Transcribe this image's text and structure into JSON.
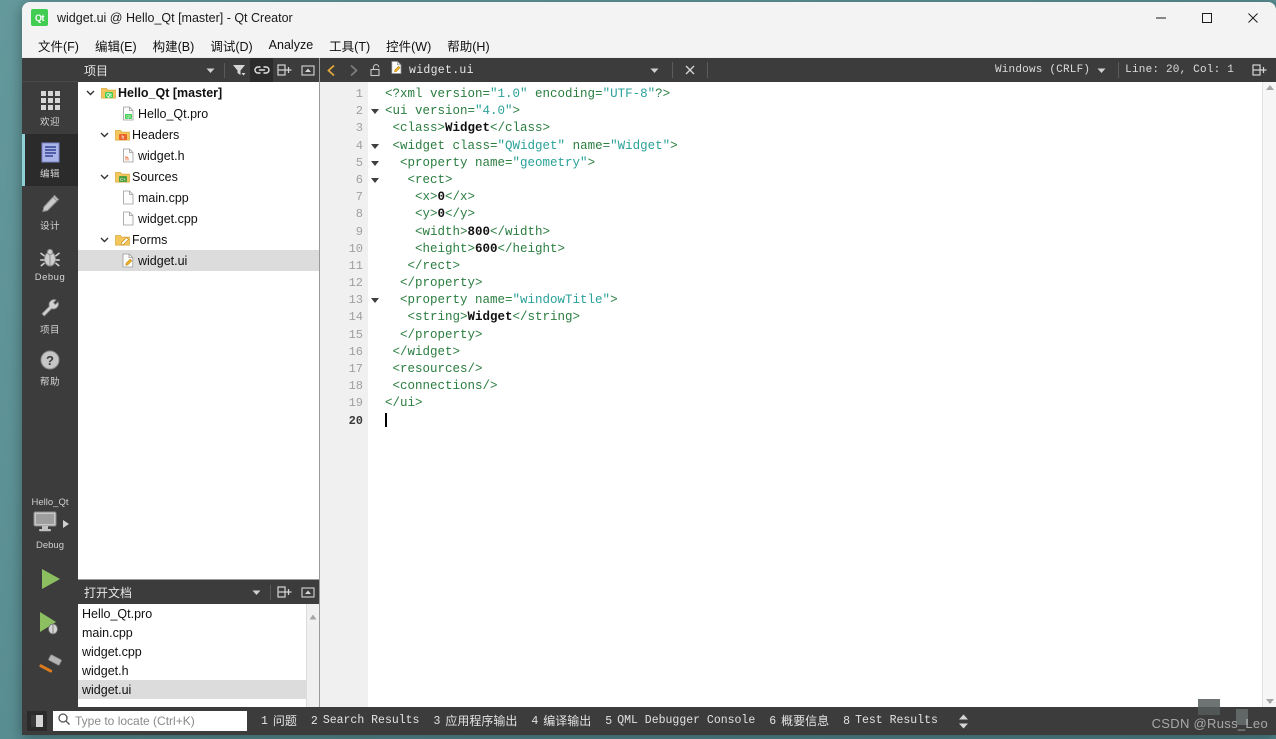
{
  "window": {
    "title": "widget.ui @ Hello_Qt [master] - Qt Creator",
    "app_icon": "qt-logo-icon",
    "minimize_label": "—",
    "maximize_label": "☐",
    "close_label": "✕"
  },
  "menubar": {
    "items": [
      {
        "label": "文件(F)"
      },
      {
        "label": "编辑(E)"
      },
      {
        "label": "构建(B)"
      },
      {
        "label": "调试(D)"
      },
      {
        "label": "Analyze"
      },
      {
        "label": "工具(T)"
      },
      {
        "label": "控件(W)"
      },
      {
        "label": "帮助(H)"
      }
    ]
  },
  "modebar": {
    "items": [
      {
        "label": "欢迎",
        "icon": "grid-icon",
        "active": false
      },
      {
        "label": "编辑",
        "icon": "document-lines-icon",
        "active": true
      },
      {
        "label": "设计",
        "icon": "pencil-icon",
        "active": false
      },
      {
        "label": "Debug",
        "icon": "bug-icon",
        "active": false
      },
      {
        "label": "项目",
        "icon": "wrench-icon",
        "active": false
      },
      {
        "label": "帮助",
        "icon": "question-circle-icon",
        "active": false
      }
    ],
    "kit_name": "Hello_Qt",
    "kit_config": "Debug",
    "kit_icon": "desktop-monitor-icon",
    "run_button": "run-icon",
    "debug_button": "debug-run-icon",
    "build_button": "hammer-icon"
  },
  "project_panel": {
    "title": "项目",
    "tools": [
      {
        "name": "combo-arrow-icon"
      },
      {
        "name": "filter-icon"
      },
      {
        "name": "link-icon",
        "active": true
      },
      {
        "name": "split-icon"
      },
      {
        "name": "close-panel-icon"
      }
    ],
    "tree": [
      {
        "label": "Hello_Qt [master]",
        "depth": 0,
        "icon": "qt-project-folder-icon",
        "expanded": true,
        "bold": true,
        "selected": false
      },
      {
        "label": "Hello_Qt.pro",
        "depth": 1,
        "icon": "qt-pro-file-icon",
        "expanded": null,
        "bold": false,
        "selected": false
      },
      {
        "label": "Headers",
        "depth": 1,
        "icon": "headers-folder-icon",
        "expanded": true,
        "bold": false,
        "selected": false
      },
      {
        "label": "widget.h",
        "depth": 2,
        "icon": "header-file-icon",
        "expanded": null,
        "bold": false,
        "selected": false
      },
      {
        "label": "Sources",
        "depth": 1,
        "icon": "sources-folder-icon",
        "expanded": true,
        "bold": false,
        "selected": false
      },
      {
        "label": "main.cpp",
        "depth": 2,
        "icon": "cpp-file-icon",
        "expanded": null,
        "bold": false,
        "selected": false
      },
      {
        "label": "widget.cpp",
        "depth": 2,
        "icon": "cpp-file-icon",
        "expanded": null,
        "bold": false,
        "selected": false
      },
      {
        "label": "Forms",
        "depth": 1,
        "icon": "forms-folder-icon",
        "expanded": true,
        "bold": false,
        "selected": false
      },
      {
        "label": "widget.ui",
        "depth": 2,
        "icon": "ui-file-icon",
        "expanded": null,
        "bold": false,
        "selected": true
      }
    ]
  },
  "open_documents": {
    "title": "打开文档",
    "tools": [
      {
        "name": "combo-arrow-icon"
      },
      {
        "name": "split-icon"
      },
      {
        "name": "close-panel-icon"
      }
    ],
    "items": [
      {
        "label": "Hello_Qt.pro",
        "selected": false
      },
      {
        "label": "main.cpp",
        "selected": false
      },
      {
        "label": "widget.cpp",
        "selected": false
      },
      {
        "label": "widget.h",
        "selected": false
      },
      {
        "label": "widget.ui",
        "selected": true
      }
    ]
  },
  "editor_toolbar": {
    "back_icon": "chevron-left-icon",
    "forward_icon": "chevron-right-icon",
    "lock_icon": "unlocked-icon",
    "file_icon": "ui-file-icon",
    "file_name": "widget.ui",
    "dropdown_icon": "chevron-down-icon",
    "close_icon": "close-icon",
    "line_ending": "Windows (CRLF)",
    "line_ending_arrow": "chevron-down-icon",
    "cursor_position": "Line: 20, Col: 1",
    "split_icon": "split-editor-icon"
  },
  "editor": {
    "current_line": 20,
    "total_lines": 20,
    "lines": [
      {
        "n": 1,
        "fold": false,
        "tokens": [
          {
            "t": "tg",
            "v": "<?xml "
          },
          {
            "t": "at",
            "v": "version="
          },
          {
            "t": "av",
            "v": "\"1.0\""
          },
          {
            "t": "at",
            "v": " encoding="
          },
          {
            "t": "av",
            "v": "\"UTF-8\""
          },
          {
            "t": "tg",
            "v": "?>"
          }
        ]
      },
      {
        "n": 2,
        "fold": true,
        "tokens": [
          {
            "t": "tg",
            "v": "<ui "
          },
          {
            "t": "at",
            "v": "version="
          },
          {
            "t": "av",
            "v": "\"4.0\""
          },
          {
            "t": "tg",
            "v": ">"
          }
        ]
      },
      {
        "n": 3,
        "fold": false,
        "tokens": [
          {
            "t": "pl",
            "v": " "
          },
          {
            "t": "tg",
            "v": "<class>"
          },
          {
            "t": "tx",
            "v": "Widget"
          },
          {
            "t": "tg",
            "v": "</class>"
          }
        ]
      },
      {
        "n": 4,
        "fold": true,
        "tokens": [
          {
            "t": "pl",
            "v": " "
          },
          {
            "t": "tg",
            "v": "<widget "
          },
          {
            "t": "at",
            "v": "class="
          },
          {
            "t": "av",
            "v": "\"QWidget\""
          },
          {
            "t": "at",
            "v": " name="
          },
          {
            "t": "av",
            "v": "\"Widget\""
          },
          {
            "t": "tg",
            "v": ">"
          }
        ]
      },
      {
        "n": 5,
        "fold": true,
        "tokens": [
          {
            "t": "pl",
            "v": "  "
          },
          {
            "t": "tg",
            "v": "<property "
          },
          {
            "t": "at",
            "v": "name="
          },
          {
            "t": "av",
            "v": "\"geometry\""
          },
          {
            "t": "tg",
            "v": ">"
          }
        ]
      },
      {
        "n": 6,
        "fold": true,
        "tokens": [
          {
            "t": "pl",
            "v": "   "
          },
          {
            "t": "tg",
            "v": "<rect>"
          }
        ]
      },
      {
        "n": 7,
        "fold": false,
        "tokens": [
          {
            "t": "pl",
            "v": "    "
          },
          {
            "t": "tg",
            "v": "<x>"
          },
          {
            "t": "tx",
            "v": "0"
          },
          {
            "t": "tg",
            "v": "</x>"
          }
        ]
      },
      {
        "n": 8,
        "fold": false,
        "tokens": [
          {
            "t": "pl",
            "v": "    "
          },
          {
            "t": "tg",
            "v": "<y>"
          },
          {
            "t": "tx",
            "v": "0"
          },
          {
            "t": "tg",
            "v": "</y>"
          }
        ]
      },
      {
        "n": 9,
        "fold": false,
        "tokens": [
          {
            "t": "pl",
            "v": "    "
          },
          {
            "t": "tg",
            "v": "<width>"
          },
          {
            "t": "tx",
            "v": "800"
          },
          {
            "t": "tg",
            "v": "</width>"
          }
        ]
      },
      {
        "n": 10,
        "fold": false,
        "tokens": [
          {
            "t": "pl",
            "v": "    "
          },
          {
            "t": "tg",
            "v": "<height>"
          },
          {
            "t": "tx",
            "v": "600"
          },
          {
            "t": "tg",
            "v": "</height>"
          }
        ]
      },
      {
        "n": 11,
        "fold": false,
        "tokens": [
          {
            "t": "pl",
            "v": "   "
          },
          {
            "t": "tg",
            "v": "</rect>"
          }
        ]
      },
      {
        "n": 12,
        "fold": false,
        "tokens": [
          {
            "t": "pl",
            "v": "  "
          },
          {
            "t": "tg",
            "v": "</property>"
          }
        ]
      },
      {
        "n": 13,
        "fold": true,
        "tokens": [
          {
            "t": "pl",
            "v": "  "
          },
          {
            "t": "tg",
            "v": "<property "
          },
          {
            "t": "at",
            "v": "name="
          },
          {
            "t": "av",
            "v": "\"windowTitle\""
          },
          {
            "t": "tg",
            "v": ">"
          }
        ]
      },
      {
        "n": 14,
        "fold": false,
        "tokens": [
          {
            "t": "pl",
            "v": "   "
          },
          {
            "t": "tg",
            "v": "<string>"
          },
          {
            "t": "tx",
            "v": "Widget"
          },
          {
            "t": "tg",
            "v": "</string>"
          }
        ]
      },
      {
        "n": 15,
        "fold": false,
        "tokens": [
          {
            "t": "pl",
            "v": "  "
          },
          {
            "t": "tg",
            "v": "</property>"
          }
        ]
      },
      {
        "n": 16,
        "fold": false,
        "tokens": [
          {
            "t": "pl",
            "v": " "
          },
          {
            "t": "tg",
            "v": "</widget>"
          }
        ]
      },
      {
        "n": 17,
        "fold": false,
        "tokens": [
          {
            "t": "pl",
            "v": " "
          },
          {
            "t": "tg",
            "v": "<resources/>"
          }
        ]
      },
      {
        "n": 18,
        "fold": false,
        "tokens": [
          {
            "t": "pl",
            "v": " "
          },
          {
            "t": "tg",
            "v": "<connections/>"
          }
        ]
      },
      {
        "n": 19,
        "fold": false,
        "tokens": [
          {
            "t": "tg",
            "v": "</ui>"
          }
        ]
      },
      {
        "n": 20,
        "fold": false,
        "tokens": [
          {
            "t": "caret",
            "v": ""
          }
        ]
      }
    ]
  },
  "statusbar": {
    "sidebar_toggle_icon": "toggle-sidebar-icon",
    "locator_icon": "search-icon",
    "locator_placeholder": "Type to locate (Ctrl+K)",
    "locator_value": "",
    "output_buttons": [
      {
        "num": "1",
        "label": "问题",
        "cjk": true
      },
      {
        "num": "2",
        "label": "Search Results",
        "cjk": false
      },
      {
        "num": "3",
        "label": "应用程序输出",
        "cjk": true
      },
      {
        "num": "4",
        "label": "编译输出",
        "cjk": true
      },
      {
        "num": "5",
        "label": "QML Debugger Console",
        "cjk": false
      },
      {
        "num": "6",
        "label": "概要信息",
        "cjk": true
      },
      {
        "num": "8",
        "label": "Test Results",
        "cjk": false
      }
    ],
    "updown_icon": "up-down-arrows-icon"
  },
  "watermark": {
    "text": "CSDN @Russ_Leo"
  },
  "colors": {
    "accent_qt_green": "#41cd52",
    "dark_chrome": "#3c3c3c",
    "darker_chrome": "#2b2b2b",
    "mode_active_stripe": "#8ed0d6",
    "selection_gray": "#dcdcdc",
    "xml_tag": "#2a7d3f",
    "xml_attr_value": "#2aa198",
    "desktop": "#5f9397"
  }
}
